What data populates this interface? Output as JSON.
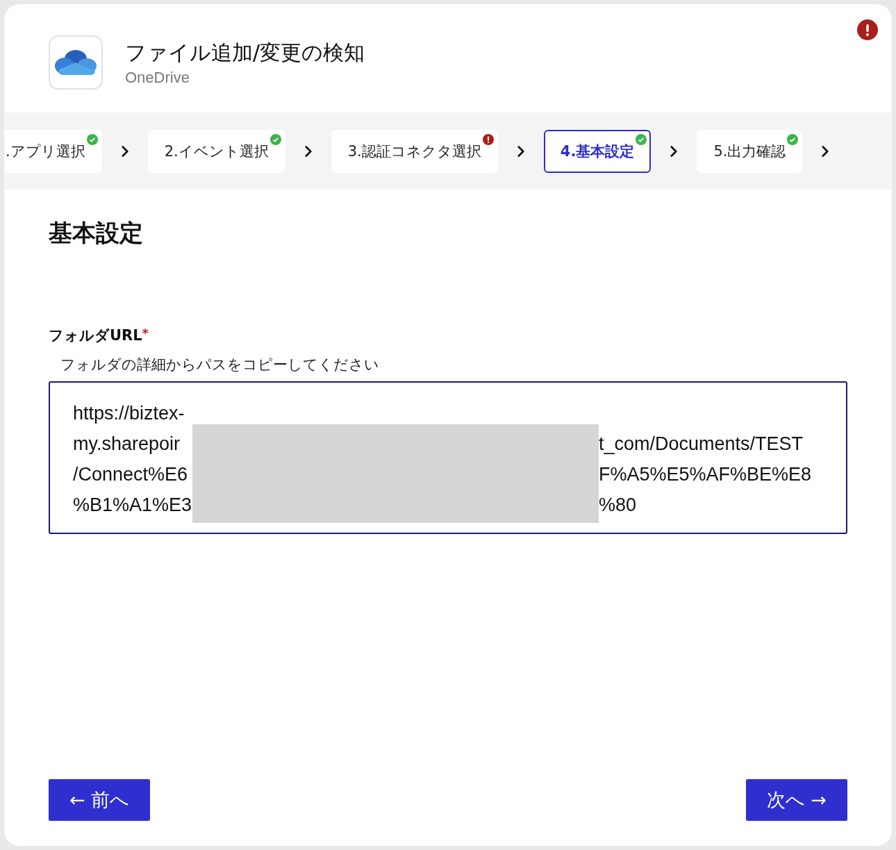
{
  "header": {
    "title": "ファイル追加/変更の検知",
    "app_name": "OneDrive",
    "alert": true
  },
  "steps": [
    {
      "label": ".アプリ選択",
      "error": false,
      "selected": false
    },
    {
      "label": "2.イベント選択",
      "error": false,
      "selected": false
    },
    {
      "label": "3.認証コネクタ選択",
      "error": true,
      "selected": false
    },
    {
      "label": "4.基本設定",
      "error": false,
      "selected": true
    },
    {
      "label": "5.出力確認",
      "error": false,
      "selected": false
    }
  ],
  "section_title": "基本設定",
  "field": {
    "label": "フォルダURL",
    "required_mark": "*",
    "hint": "フォルダの詳細からパスをコピーしてください",
    "lines": [
      {
        "left": "https://biztex-"
      },
      {
        "left": "my.sharepoir",
        "right": "t_com/Documents/TEST"
      },
      {
        "left": "/Connect%E6",
        "right": "F%A5%E5%AF%BE%E8"
      },
      {
        "left": "%B1%A1%E3",
        "right": "%80"
      }
    ]
  },
  "buttons": {
    "back": "← 前へ",
    "next": "次へ →"
  }
}
